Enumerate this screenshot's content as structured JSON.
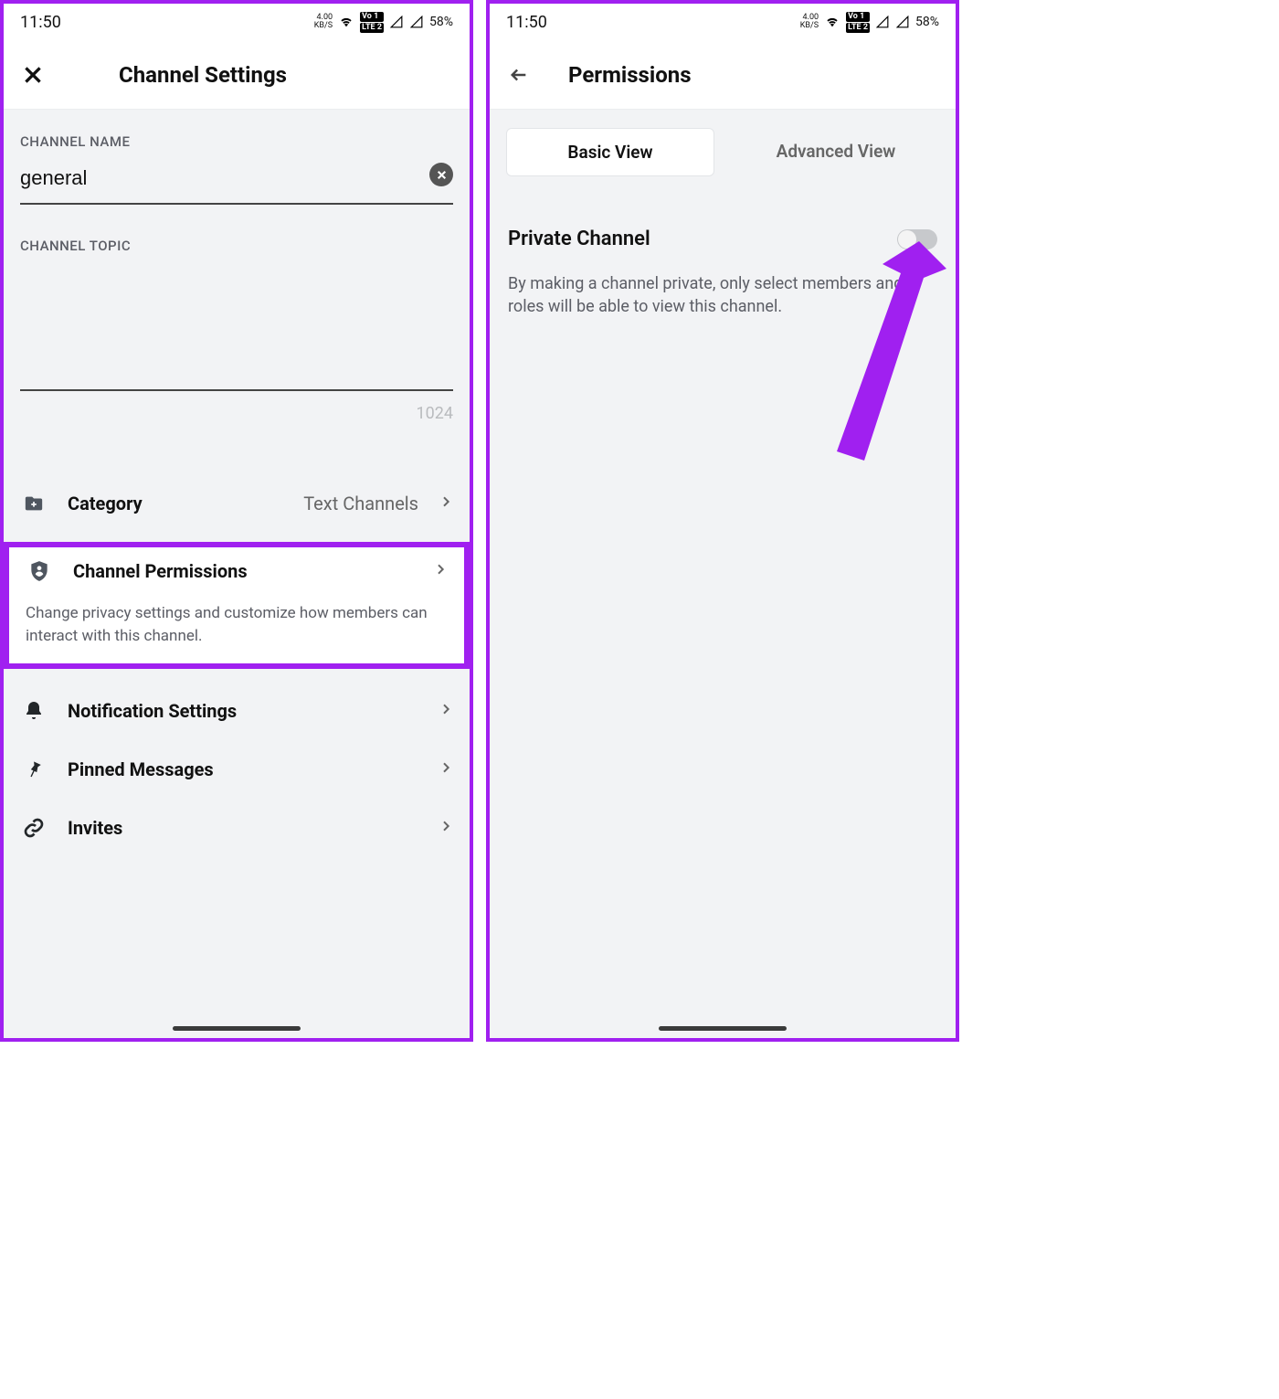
{
  "status": {
    "time": "11:50",
    "kbps_top": "4.00",
    "kbps_bottom": "KB/S",
    "lte1": "Vo 1",
    "lte2": "LTE 2",
    "battery": "58%"
  },
  "left": {
    "title": "Channel Settings",
    "channel_name_label": "CHANNEL NAME",
    "channel_name_value": "general",
    "channel_topic_label": "CHANNEL TOPIC",
    "char_limit": "1024",
    "items": {
      "category": {
        "label": "Category",
        "value": "Text Channels"
      },
      "permissions": {
        "label": "Channel Permissions",
        "desc": "Change privacy settings and customize how members can interact with this channel."
      },
      "notifications": {
        "label": "Notification Settings"
      },
      "pinned": {
        "label": "Pinned Messages"
      },
      "invites": {
        "label": "Invites"
      }
    }
  },
  "right": {
    "title": "Permissions",
    "basic": "Basic View",
    "advanced": "Advanced View",
    "private_label": "Private Channel",
    "private_desc": "By making a channel private, only select members and roles will be able to view this channel."
  }
}
